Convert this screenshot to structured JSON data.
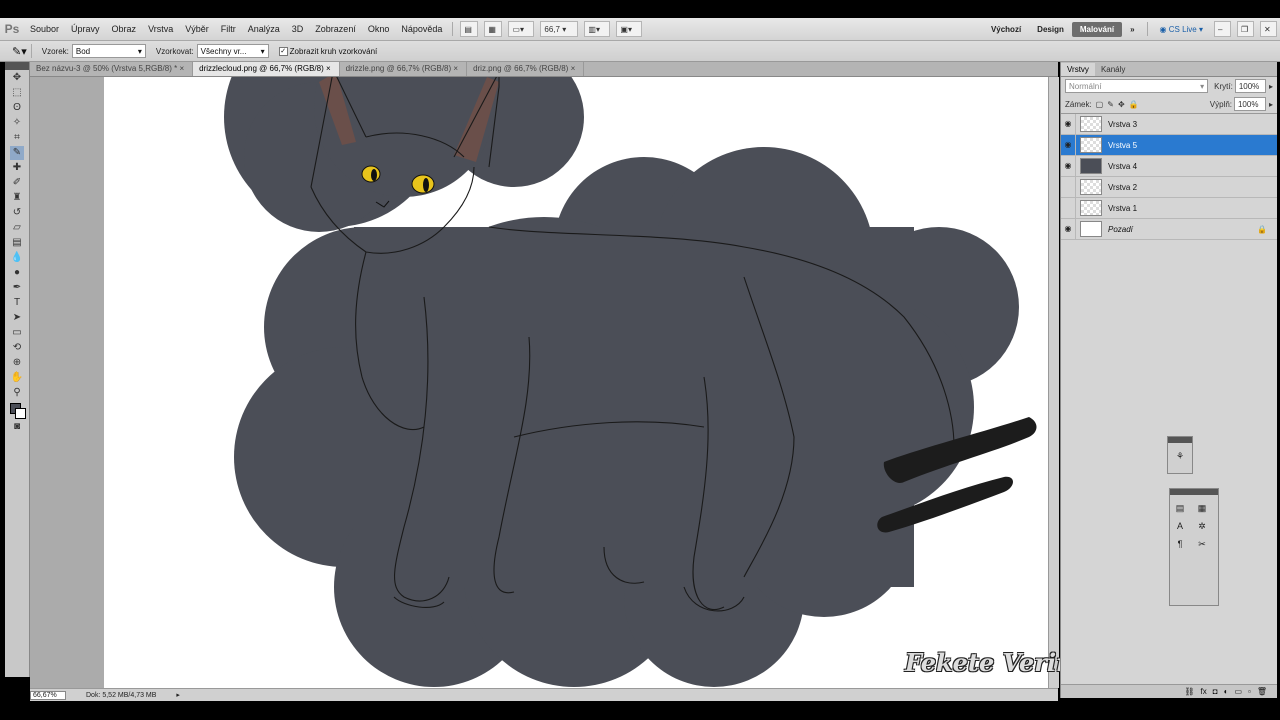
{
  "menu": [
    "Soubor",
    "Úpravy",
    "Obraz",
    "Vrstva",
    "Výběr",
    "Filtr",
    "Analýza",
    "3D",
    "Zobrazení",
    "Okno",
    "Nápověda"
  ],
  "zoom_box": "66,7",
  "workspaces": {
    "default": "Výchozí",
    "design": "Design",
    "painting": "Malování"
  },
  "cs_live": "CS Live",
  "options": {
    "sample_label": "Vzorek:",
    "sample_value": "Bod",
    "sampling_label": "Vzorkovat:",
    "sampling_value": "Všechny vr...",
    "ring_label": "Zobrazit kruh vzorkování"
  },
  "tabs": [
    "Bez názvu-3 @ 50% (Vrstva 5,RGB/8) *",
    "drizzlecloud.png @ 66,7% (RGB/8)",
    "drizzle.png @ 66,7% (RGB/8)",
    "driz.png @ 66,7% (RGB/8)"
  ],
  "status": {
    "zoom": "66,67%",
    "doc": "Dok: 5,52 MB/4,73 MB"
  },
  "panel": {
    "tabs": [
      "Vrstvy",
      "Kanály"
    ],
    "blend_mode": "Normální",
    "opacity_label": "Krytí:",
    "opacity_value": "100%",
    "lock_label": "Zámek:",
    "fill_label": "Výplň:",
    "fill_value": "100%",
    "layers": [
      "Vrstva 3",
      "Vrstva 5",
      "Vrstva 4",
      "Vrstva 2",
      "Vrstva 1",
      "Pozadí"
    ]
  },
  "watermark": "Fekete Verinen Stjerne",
  "colors": {
    "cloud": "#4b4e57",
    "eye": "#e8c41c",
    "ear_inner": "#6a4f4a",
    "tail_stroke": "#1c1c1c",
    "selection": "#2a7ad0"
  }
}
